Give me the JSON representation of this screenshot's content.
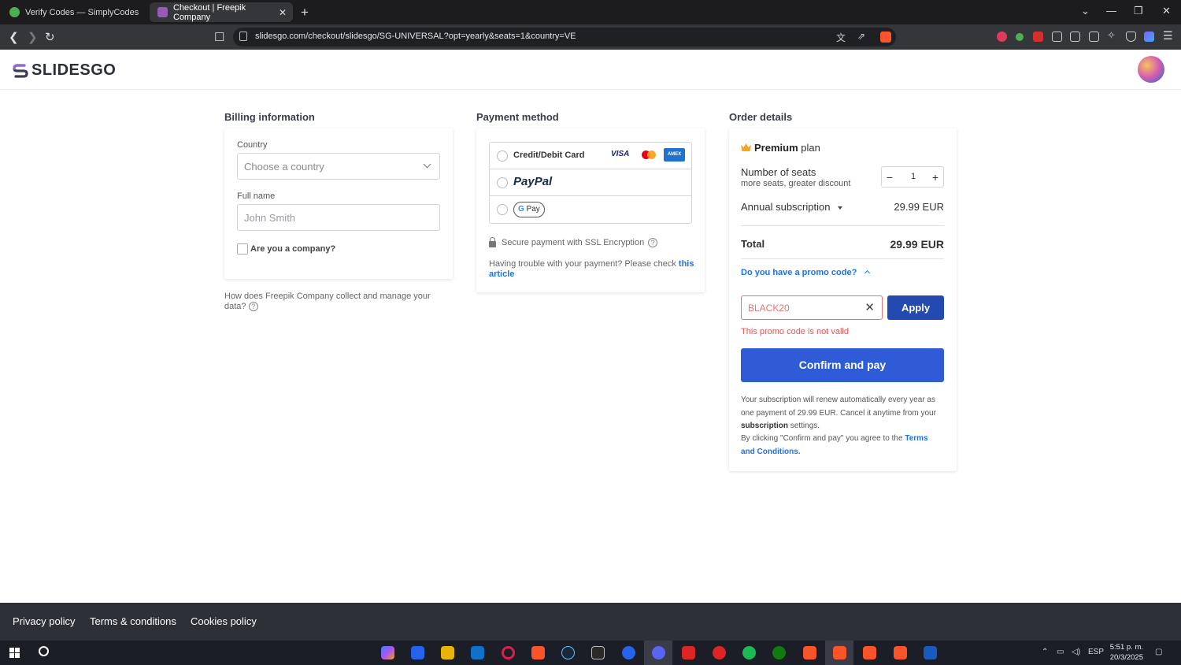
{
  "browser": {
    "tabs": [
      {
        "title": "Verify Codes — SimplyCodes",
        "active": false
      },
      {
        "title": "Checkout | Freepik Company",
        "active": true
      }
    ],
    "url": "slidesgo.com/checkout/slidesgo/SG-UNIVERSAL?opt=yearly&seats=1&country=VE"
  },
  "site": {
    "logo": "SLIDESGO"
  },
  "billing": {
    "title": "Billing information",
    "country_label": "Country",
    "country_placeholder": "Choose a country",
    "fullname_label": "Full name",
    "fullname_placeholder": "John Smith",
    "company_label": "Are you a company?",
    "data_note": "How does Freepik Company collect and manage your data?"
  },
  "payment": {
    "title": "Payment method",
    "options": [
      {
        "label": "Credit/Debit Card"
      },
      {
        "label": "PayPal"
      },
      {
        "label": "G Pay"
      }
    ],
    "card_brands": [
      "VISA",
      "mastercard",
      "AMEX"
    ],
    "secure_text": "Secure payment with SSL Encryption",
    "trouble_text": "Having trouble with your payment? Please check",
    "trouble_link": "this article"
  },
  "order": {
    "title": "Order details",
    "plan_name": "Premium",
    "plan_suffix": "plan",
    "seats_title": "Number of seats",
    "seats_sub": "more seats, greater discount",
    "seats_value": "1",
    "subscription_label": "Annual subscription",
    "subscription_price": "29.99 EUR",
    "total_label": "Total",
    "total_value": "29.99 EUR",
    "promo_question": "Do you have a promo code?",
    "promo_value": "BLACK20",
    "apply_label": "Apply",
    "promo_error": "This promo code is not valid",
    "confirm_label": "Confirm and pay",
    "renew_text_1": "Your subscription will renew automatically every year as one payment of 29.99 EUR. Cancel it anytime from your",
    "renew_bold": "subscription",
    "renew_text_2": "settings.",
    "agree_text": "By clicking \"Confirm and pay\" you agree to the",
    "terms_link": "Terms and Conditions."
  },
  "footer": {
    "links": [
      "Privacy policy",
      "Terms & conditions",
      "Cookies policy"
    ]
  },
  "taskbar": {
    "lang": "ESP",
    "time": "5:51 p. m.",
    "date": "20/3/2025"
  },
  "colors": {
    "primary": "#2f5bd6",
    "apply": "#234ab0",
    "error": "#e55353",
    "link": "#1a73e8",
    "footer": "#2e3038"
  }
}
